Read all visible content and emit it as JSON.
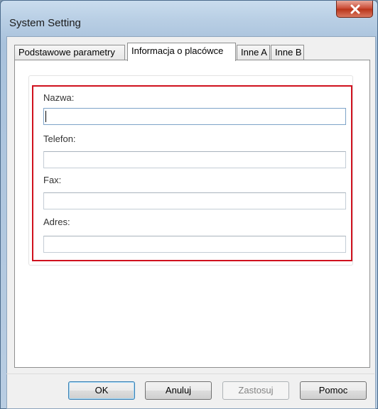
{
  "window": {
    "title": "System Setting"
  },
  "tabs": [
    {
      "label": "Podstawowe parametry",
      "active": false
    },
    {
      "label": "Informacja o placówce",
      "active": true
    },
    {
      "label": "Inne A",
      "active": false
    },
    {
      "label": "Inne B",
      "active": false
    }
  ],
  "form": {
    "name_label": "Nazwa:",
    "name_value": "",
    "phone_label": "Telefon:",
    "phone_value": "",
    "fax_label": "Fax:",
    "fax_value": "",
    "address_label": "Adres:",
    "address_value": ""
  },
  "buttons": {
    "ok": "OK",
    "cancel": "Anuluj",
    "apply": "Zastosuj",
    "help": "Pomoc"
  },
  "colors": {
    "highlight": "#d0111e",
    "close_button": "#c8452f"
  }
}
